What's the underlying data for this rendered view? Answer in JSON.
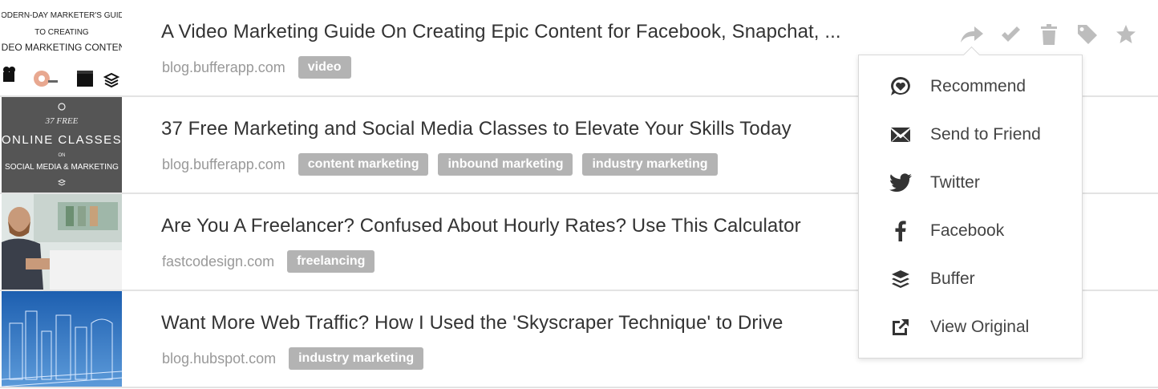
{
  "articles": [
    {
      "title": "A Video Marketing Guide On Creating Epic Content for Facebook, Snapchat, ...",
      "domain": "blog.bufferapp.com",
      "tags": [
        "video"
      ],
      "thumb_lines": [
        "MODERN-DAY MARKETER'S GUIDE",
        "TO CREATING",
        "VIDEO MARKETING CONTENT"
      ]
    },
    {
      "title": "37 Free Marketing and Social Media Classes to Elevate Your Skills Today",
      "domain": "blog.bufferapp.com",
      "tags": [
        "content marketing",
        "inbound marketing",
        "industry marketing"
      ],
      "thumb_lines": [
        "37 FREE",
        "ONLINE CLASSES",
        "ON",
        "SOCIAL MEDIA & MARKETING"
      ]
    },
    {
      "title": "Are You A Freelancer? Confused About Hourly Rates? Use This Calculator",
      "domain": "fastcodesign.com",
      "tags": [
        "freelancing"
      ]
    },
    {
      "title": "Want More Web Traffic? How I Used the 'Skyscraper Technique' to Drive",
      "domain": "blog.hubspot.com",
      "tags": [
        "industry marketing"
      ]
    }
  ],
  "actions": [
    {
      "icon": "share-icon"
    },
    {
      "icon": "check-icon"
    },
    {
      "icon": "trash-icon"
    },
    {
      "icon": "tag-icon"
    },
    {
      "icon": "star-icon"
    }
  ],
  "share_menu": {
    "items": [
      {
        "label": "Recommend",
        "icon": "recommend-icon"
      },
      {
        "label": "Send to Friend",
        "icon": "envelope-icon"
      },
      {
        "label": "Twitter",
        "icon": "twitter-icon"
      },
      {
        "label": "Facebook",
        "icon": "facebook-icon"
      },
      {
        "label": "Buffer",
        "icon": "buffer-icon"
      },
      {
        "label": "View Original",
        "icon": "external-link-icon"
      }
    ]
  },
  "colors": {
    "tag_bg": "#b3b3b3",
    "icon_gray": "#bdbdbd",
    "text_dark": "#333333",
    "domain_gray": "#999999"
  }
}
